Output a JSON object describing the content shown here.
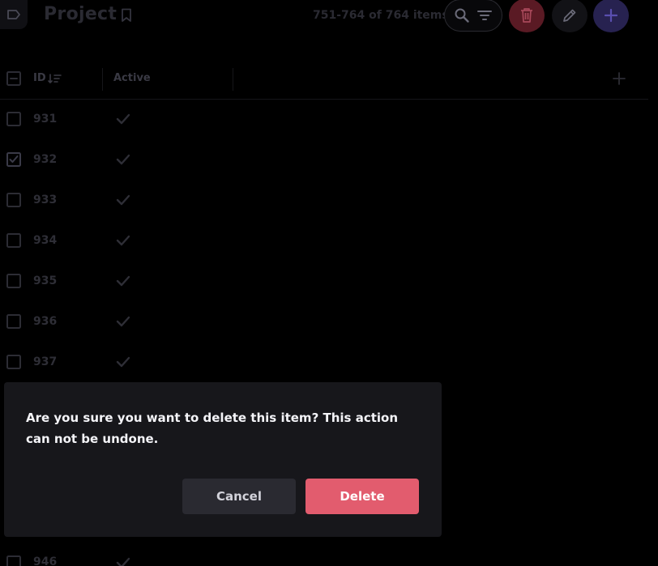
{
  "header": {
    "title": "Project",
    "item_count": "751-764 of 764 items"
  },
  "icons": {
    "sidebar": "sidebar-toggle-icon",
    "bookmark": "bookmark-icon",
    "search": "search-icon",
    "filter": "filter-icon",
    "delete": "trash-icon",
    "edit": "pencil-icon",
    "add": "plus-icon"
  },
  "table": {
    "columns": [
      "ID",
      "Active"
    ],
    "rows": [
      {
        "id": "931",
        "active": true,
        "selected": false
      },
      {
        "id": "932",
        "active": true,
        "selected": true
      },
      {
        "id": "933",
        "active": true,
        "selected": false
      },
      {
        "id": "934",
        "active": true,
        "selected": false
      },
      {
        "id": "935",
        "active": true,
        "selected": false
      },
      {
        "id": "936",
        "active": true,
        "selected": false
      },
      {
        "id": "937",
        "active": true,
        "selected": false
      }
    ],
    "partial_row": {
      "id": "946",
      "active": true,
      "selected": false
    }
  },
  "dialog": {
    "message": "Are you sure you want to delete this item? This action can not be undone.",
    "cancel_label": "Cancel",
    "confirm_label": "Delete"
  },
  "colors": {
    "background": "#000000",
    "dialog_bg": "#17171b",
    "delete_accent": "#e25c6e",
    "primary_accent": "#272250",
    "muted_text": "#2e2e36"
  }
}
